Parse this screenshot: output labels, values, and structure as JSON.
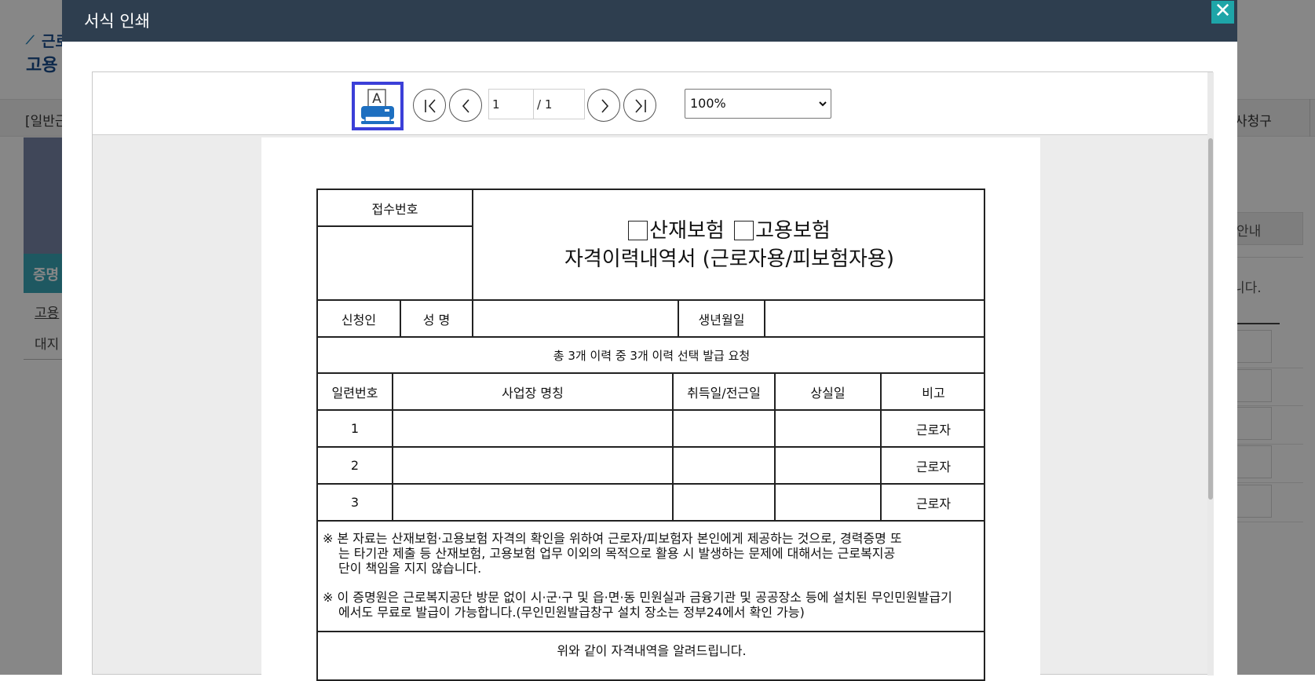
{
  "background": {
    "logo_top": "근로",
    "logo_bottom": "고용",
    "nav_left": "[일반근",
    "nav_right": "사청구",
    "side_tab": "증명",
    "side_link1": "고용",
    "side_link2": "대지",
    "right_button": "안내",
    "right_text": "니다."
  },
  "modal": {
    "title": "서식 인쇄",
    "close_glyph": "✕"
  },
  "toolbar": {
    "print_glyph": "A",
    "current_page": "1",
    "total_pages": "/ 1",
    "zoom": "100%"
  },
  "form": {
    "receipt_label": "접수번호",
    "title_line1_a": "산재보험",
    "title_line1_b": "고용보험",
    "title_line2": "자격이력내역서 (근로자용/피보험자용)",
    "applicant_label": "신청인",
    "name_label": "성 명",
    "birth_label": "생년월일",
    "summary": "총  3개 이력 중 3개 이력 선택 발급 요청",
    "columns": [
      "일련번호",
      "사업장 명칭",
      "취득일/전근일",
      "상실일",
      "비고"
    ],
    "rows": [
      {
        "no": "1",
        "workplace": "",
        "acquired": "",
        "lost": "",
        "note": "근로자"
      },
      {
        "no": "2",
        "workplace": "",
        "acquired": "",
        "lost": "",
        "note": "근로자"
      },
      {
        "no": "3",
        "workplace": "",
        "acquired": "",
        "lost": "",
        "note": "근로자"
      }
    ],
    "note1": "※ 본 자료는 산재보험·고용보험 자격의 확인을 위하여 근로자/피보험자 본인에게 제공하는 것으로, 경력증명 또는 타기관 제출 등 산재보험, 고용보험 업무 이외의 목적으로 활용 시 발생하는 문제에 대해서는 근로복지공단이 책임을 지지 않습니다.",
    "note2": "※ 이 증명원은 근로복지공단 방문 없이 시·군·구 및 읍·면·동 민원실과 금융기관 및 공공장소 등에 설치된 무인민원발급기에서도 무료로 발급이 가능합니다.(무인민원발급창구 설치 장소는 정부24에서 확인 가능)",
    "footer": "위와 같이 자격내역을 알려드립니다."
  }
}
